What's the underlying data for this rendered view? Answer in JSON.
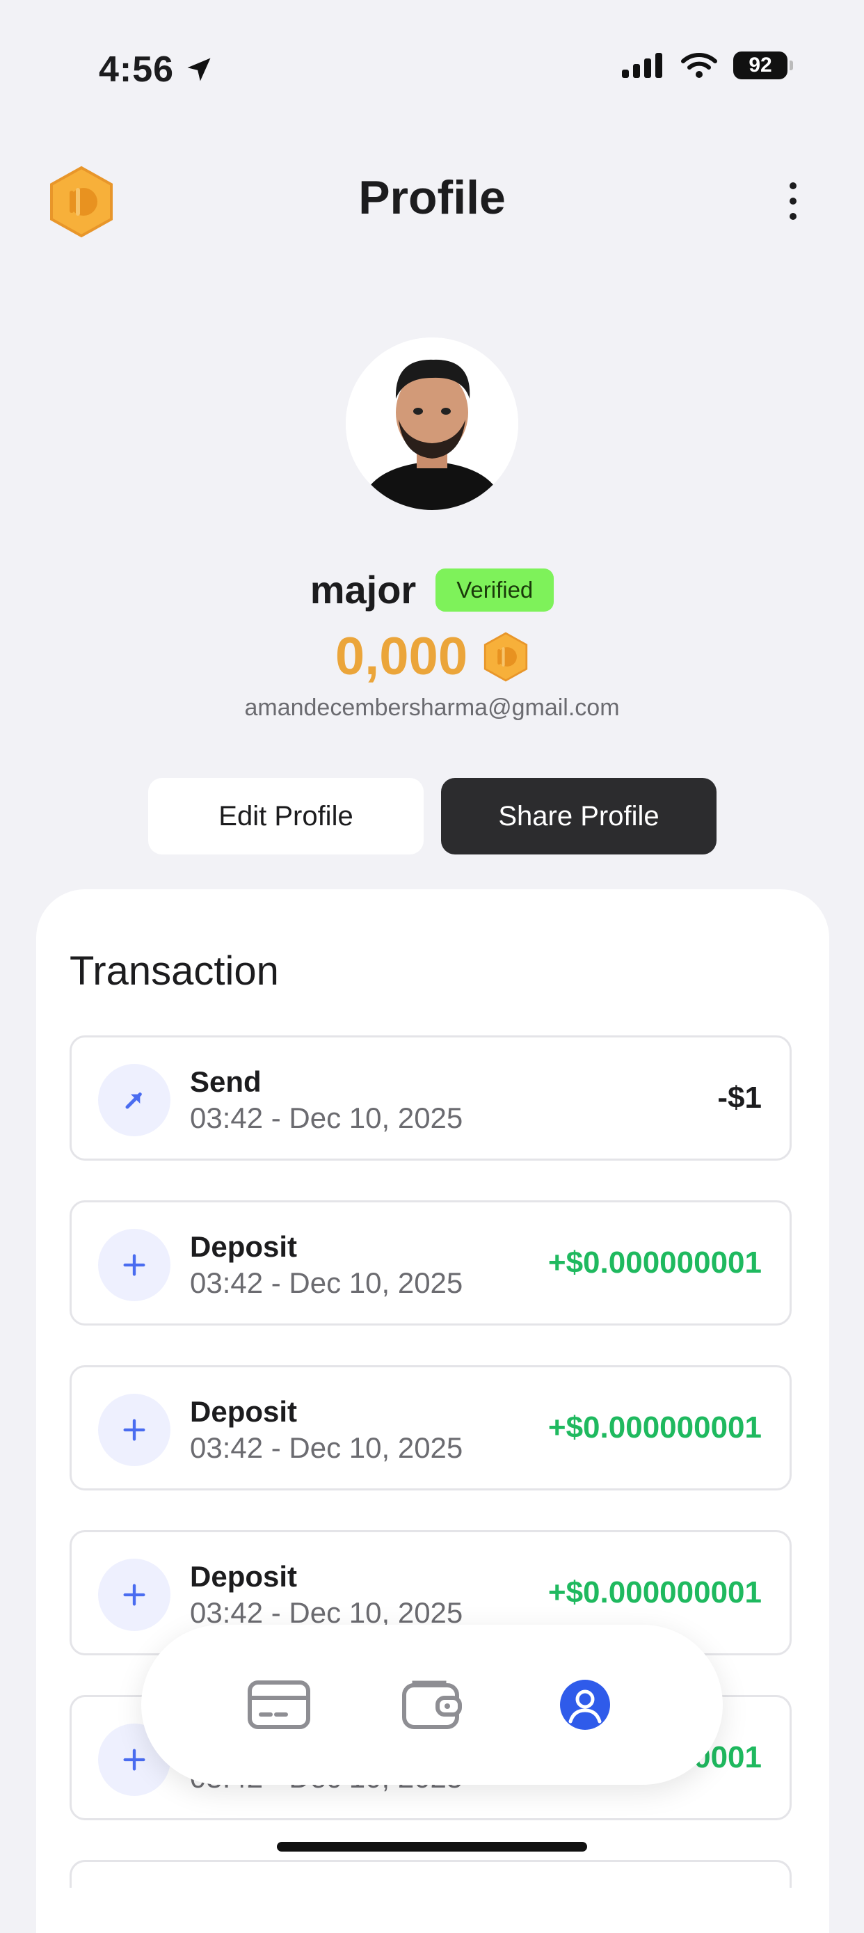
{
  "status_bar": {
    "time": "4:56",
    "battery": "92"
  },
  "header": {
    "title": "Profile"
  },
  "profile": {
    "username": "major",
    "badge": "Verified",
    "balance": "0,000",
    "email": "amandecembersharma@gmail.com"
  },
  "actions": {
    "edit_label": "Edit Profile",
    "share_label": "Share Profile"
  },
  "transactions": {
    "title": "Transaction",
    "items": [
      {
        "type": "Send",
        "time": "03:42 - Dec 10, 2025",
        "amount": "-$1",
        "icon": "arrow-up-right-icon"
      },
      {
        "type": "Deposit",
        "time": "03:42 - Dec 10, 2025",
        "amount": "+$0.000000001",
        "icon": "plus-icon"
      },
      {
        "type": "Deposit",
        "time": "03:42 - Dec 10, 2025",
        "amount": "+$0.000000001",
        "icon": "plus-icon"
      },
      {
        "type": "Deposit",
        "time": "03:42 - Dec 10, 2025",
        "amount": "+$0.000000001",
        "icon": "plus-icon"
      },
      {
        "type": "Deposit",
        "time": "03:42 - Dec 10, 2025",
        "amount": "+$0.000000001",
        "icon": "plus-icon"
      }
    ]
  },
  "tabbar": {
    "items": [
      {
        "icon": "card-icon",
        "active": false
      },
      {
        "icon": "wallet-icon",
        "active": false
      },
      {
        "icon": "profile-icon",
        "active": true
      }
    ]
  },
  "colors": {
    "accent": "#2f5bea",
    "coin": "#f5a623",
    "positive": "#1fb95f",
    "verified": "#7ef25a"
  }
}
